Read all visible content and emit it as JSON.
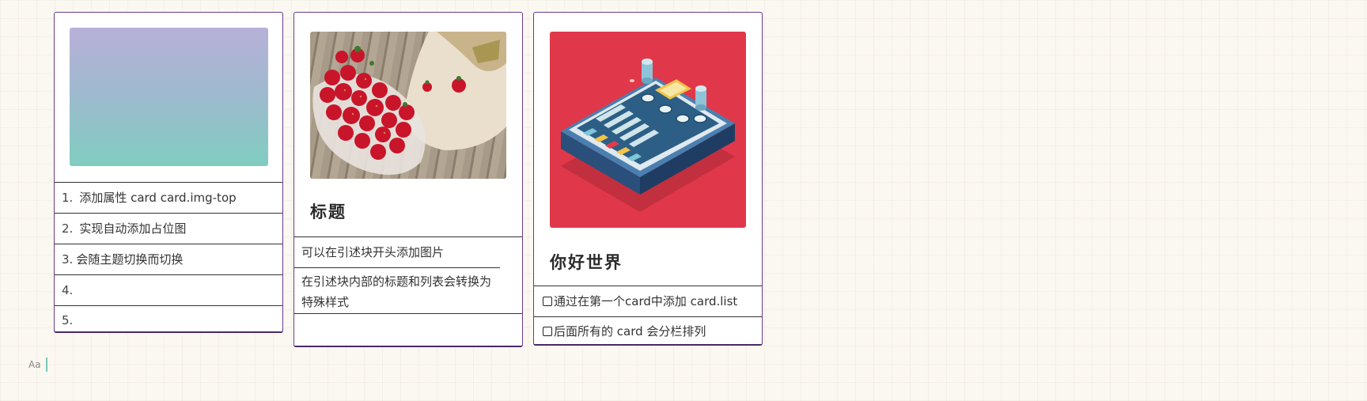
{
  "cards": [
    {
      "image": "gradient-placeholder",
      "items": [
        {
          "num": "1.",
          "text": "添加属性 card card.img-top"
        },
        {
          "num": "2.",
          "text": "实现自动添加占位图"
        },
        {
          "num": "3.",
          "text": "会随主题切换而切换"
        },
        {
          "num": "4.",
          "text": ""
        },
        {
          "num": "5.",
          "text": ""
        }
      ]
    },
    {
      "image": "strawberries-photo",
      "title": "标题",
      "items": [
        {
          "text": "可以在引述块开头添加图片"
        },
        {
          "text": "在引述块内部的标题和列表会转换为特殊样式"
        },
        {
          "text": ""
        }
      ]
    },
    {
      "image": "isometric-control-panel",
      "title": "你好世界",
      "items": [
        {
          "text": "通过在第一个card中添加 card.list"
        },
        {
          "text": "后面所有的 card 会分栏排列"
        }
      ]
    }
  ],
  "editor": {
    "hint": "Aa"
  },
  "colors": {
    "border": "#6b3a93",
    "background": "#fbf8f1",
    "accent_red": "#e0384a"
  }
}
